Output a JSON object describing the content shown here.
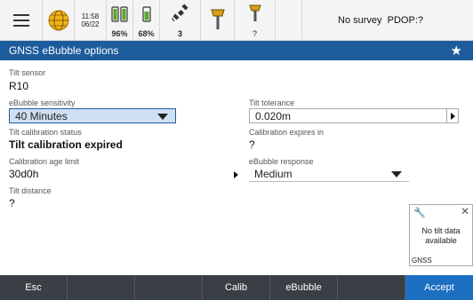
{
  "statusbar": {
    "time": "11:58",
    "date": "06/22",
    "battery1_pct": "96%",
    "battery2_pct": "68%",
    "satellites": "3",
    "receiver2_label": "?",
    "survey_status": "No survey",
    "pdop": "PDOP:?"
  },
  "title": {
    "text": "GNSS eBubble options"
  },
  "form": {
    "tilt_sensor_label": "Tilt sensor",
    "tilt_sensor_value": "R10",
    "sensitivity_label": "eBubble sensitivity",
    "sensitivity_value": "40 Minutes",
    "tolerance_label": "Tilt tolerance",
    "tolerance_value": "0.020m",
    "calibration_status_label": "Tilt calibration status",
    "calibration_status_value": "Tilt calibration expired",
    "calibration_expires_label": "Calibration expires in",
    "calibration_expires_value": "?",
    "age_limit_label": "Calibration age limit",
    "age_limit_value": "30d0h",
    "response_label": "eBubble response",
    "response_value": "Medium",
    "tilt_distance_label": "Tilt distance",
    "tilt_distance_value": "?"
  },
  "bubble": {
    "message": "No tilt data available",
    "tag": "GNSS"
  },
  "softkeys": {
    "esc": "Esc",
    "calib": "Calib",
    "ebubble": "eBubble",
    "accept": "Accept"
  }
}
